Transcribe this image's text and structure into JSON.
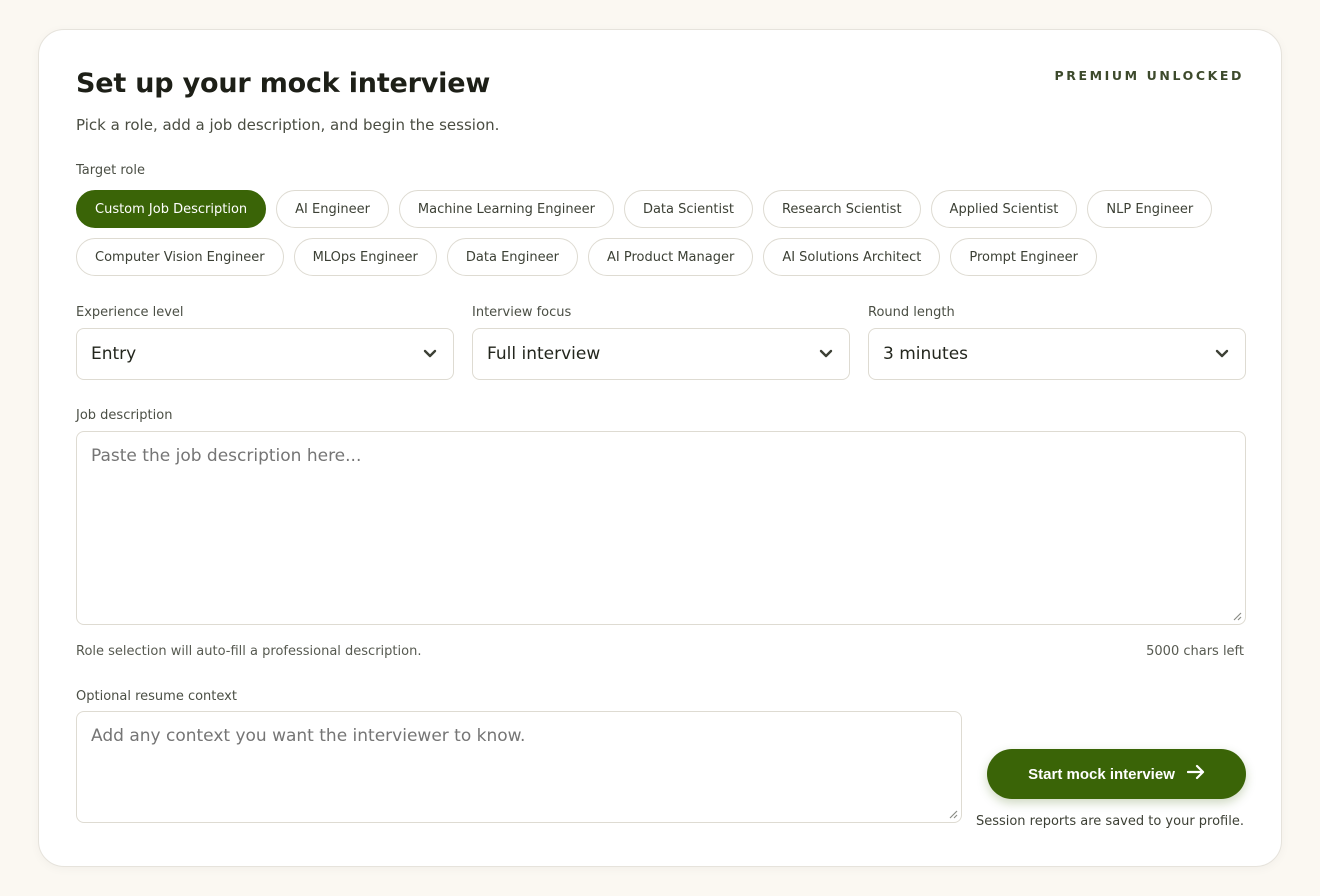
{
  "header": {
    "title": "Set up your mock interview",
    "subtitle": "Pick a role, add a job description, and begin the session.",
    "badge": "PREMIUM UNLOCKED"
  },
  "target_role": {
    "label": "Target role",
    "chips_row1": [
      "Custom Job Description",
      "AI Engineer",
      "Machine Learning Engineer",
      "Data Scientist",
      "Research Scientist",
      "Applied Scientist",
      "NLP Engineer"
    ],
    "chips_row2": [
      "Computer Vision Engineer",
      "MLOps Engineer",
      "Data Engineer",
      "AI Product Manager",
      "AI Solutions Architect",
      "Prompt Engineer"
    ],
    "selected": "Custom Job Description"
  },
  "experience": {
    "label": "Experience level",
    "value": "Entry"
  },
  "focus": {
    "label": "Interview focus",
    "value": "Full interview"
  },
  "round": {
    "label": "Round length",
    "value": "3 minutes"
  },
  "job_description": {
    "label": "Job description",
    "placeholder": "Paste the job description here...",
    "value": "",
    "hint": "Role selection will auto-fill a professional description.",
    "chars_left": "5000 chars left"
  },
  "resume": {
    "label": "Optional resume context",
    "placeholder": "Add any context you want the interviewer to know.",
    "value": ""
  },
  "actions": {
    "start_label": "Start mock interview",
    "start_icon": "arrow-right-icon",
    "note": "Session reports are saved to your profile."
  },
  "colors": {
    "accent": "#3a6407",
    "background": "#fbf8f2",
    "card": "#ffffff",
    "border": "#dedbd2"
  }
}
